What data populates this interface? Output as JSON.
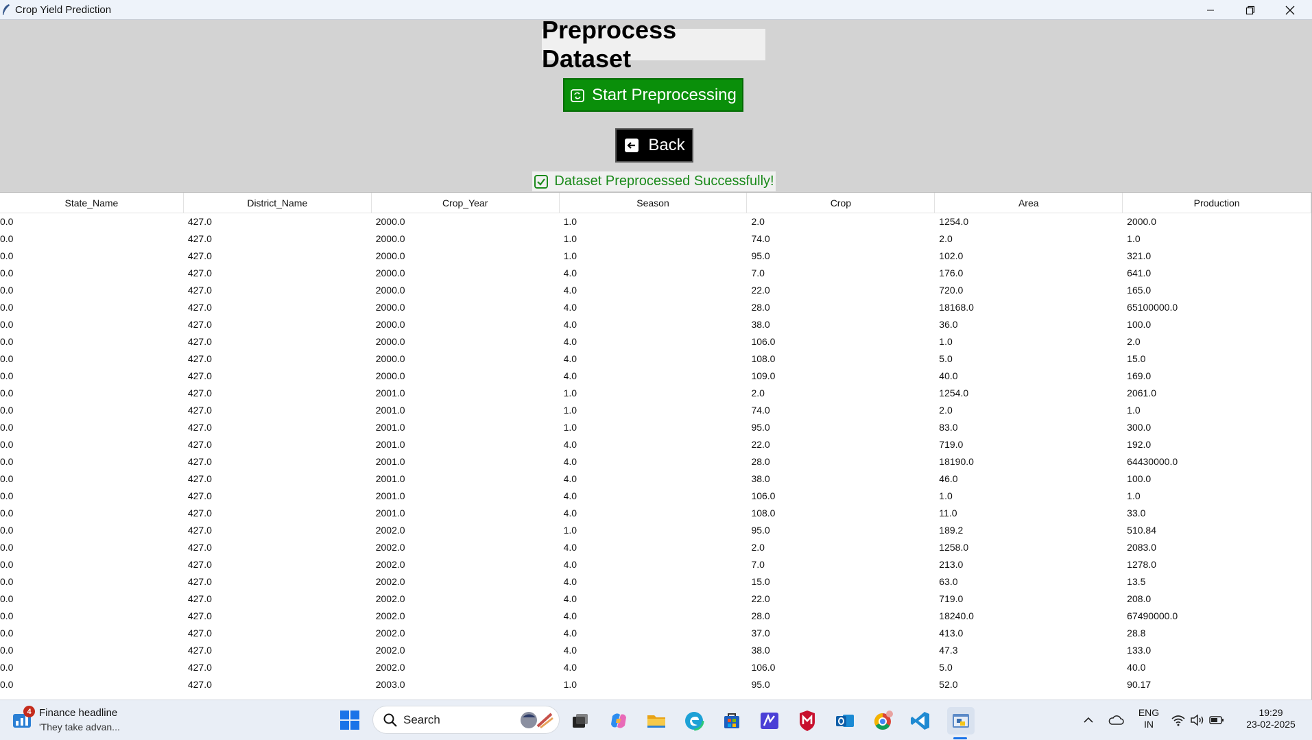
{
  "window": {
    "title": "Crop Yield Prediction"
  },
  "main": {
    "heading": "Preprocess Dataset",
    "start_button": "Start Preprocessing",
    "back_button": "Back",
    "status_message": "Dataset Preprocessed Successfully!"
  },
  "table": {
    "columns": [
      "State_Name",
      "District_Name",
      "Crop_Year",
      "Season",
      "Crop",
      "Area",
      "Production"
    ],
    "rows": [
      [
        "0.0",
        "427.0",
        "2000.0",
        "1.0",
        "2.0",
        "1254.0",
        "2000.0"
      ],
      [
        "0.0",
        "427.0",
        "2000.0",
        "1.0",
        "74.0",
        "2.0",
        "1.0"
      ],
      [
        "0.0",
        "427.0",
        "2000.0",
        "1.0",
        "95.0",
        "102.0",
        "321.0"
      ],
      [
        "0.0",
        "427.0",
        "2000.0",
        "4.0",
        "7.0",
        "176.0",
        "641.0"
      ],
      [
        "0.0",
        "427.0",
        "2000.0",
        "4.0",
        "22.0",
        "720.0",
        "165.0"
      ],
      [
        "0.0",
        "427.0",
        "2000.0",
        "4.0",
        "28.0",
        "18168.0",
        "65100000.0"
      ],
      [
        "0.0",
        "427.0",
        "2000.0",
        "4.0",
        "38.0",
        "36.0",
        "100.0"
      ],
      [
        "0.0",
        "427.0",
        "2000.0",
        "4.0",
        "106.0",
        "1.0",
        "2.0"
      ],
      [
        "0.0",
        "427.0",
        "2000.0",
        "4.0",
        "108.0",
        "5.0",
        "15.0"
      ],
      [
        "0.0",
        "427.0",
        "2000.0",
        "4.0",
        "109.0",
        "40.0",
        "169.0"
      ],
      [
        "0.0",
        "427.0",
        "2001.0",
        "1.0",
        "2.0",
        "1254.0",
        "2061.0"
      ],
      [
        "0.0",
        "427.0",
        "2001.0",
        "1.0",
        "74.0",
        "2.0",
        "1.0"
      ],
      [
        "0.0",
        "427.0",
        "2001.0",
        "1.0",
        "95.0",
        "83.0",
        "300.0"
      ],
      [
        "0.0",
        "427.0",
        "2001.0",
        "4.0",
        "22.0",
        "719.0",
        "192.0"
      ],
      [
        "0.0",
        "427.0",
        "2001.0",
        "4.0",
        "28.0",
        "18190.0",
        "64430000.0"
      ],
      [
        "0.0",
        "427.0",
        "2001.0",
        "4.0",
        "38.0",
        "46.0",
        "100.0"
      ],
      [
        "0.0",
        "427.0",
        "2001.0",
        "4.0",
        "106.0",
        "1.0",
        "1.0"
      ],
      [
        "0.0",
        "427.0",
        "2001.0",
        "4.0",
        "108.0",
        "11.0",
        "33.0"
      ],
      [
        "0.0",
        "427.0",
        "2002.0",
        "1.0",
        "95.0",
        "189.2",
        "510.84"
      ],
      [
        "0.0",
        "427.0",
        "2002.0",
        "4.0",
        "2.0",
        "1258.0",
        "2083.0"
      ],
      [
        "0.0",
        "427.0",
        "2002.0",
        "4.0",
        "7.0",
        "213.0",
        "1278.0"
      ],
      [
        "0.0",
        "427.0",
        "2002.0",
        "4.0",
        "15.0",
        "63.0",
        "13.5"
      ],
      [
        "0.0",
        "427.0",
        "2002.0",
        "4.0",
        "22.0",
        "719.0",
        "208.0"
      ],
      [
        "0.0",
        "427.0",
        "2002.0",
        "4.0",
        "28.0",
        "18240.0",
        "67490000.0"
      ],
      [
        "0.0",
        "427.0",
        "2002.0",
        "4.0",
        "37.0",
        "413.0",
        "28.8"
      ],
      [
        "0.0",
        "427.0",
        "2002.0",
        "4.0",
        "38.0",
        "47.3",
        "133.0"
      ],
      [
        "0.0",
        "427.0",
        "2002.0",
        "4.0",
        "106.0",
        "5.0",
        "40.0"
      ],
      [
        "0.0",
        "427.0",
        "2003.0",
        "1.0",
        "95.0",
        "52.0",
        "90.17"
      ]
    ]
  },
  "taskbar": {
    "news_badge": "4",
    "news_title": "Finance headline",
    "news_subtitle": "'They take advan...",
    "search_label": "Search",
    "language_top": "ENG",
    "language_bottom": "IN",
    "time": "19:29",
    "date": "23-02-2025"
  },
  "colors": {
    "start_button": "#0a8f0a",
    "back_button": "#000000",
    "status_text": "#1b8a1b",
    "background": "#d3d3d3"
  }
}
